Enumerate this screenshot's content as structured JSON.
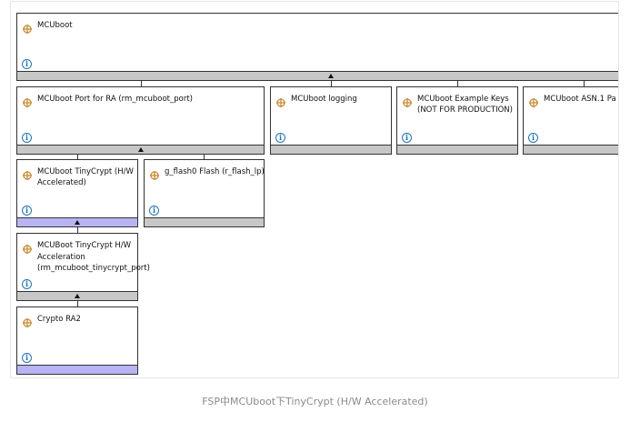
{
  "blocks": {
    "mcuboot": {
      "title": "MCUboot"
    },
    "port": {
      "title": "MCUboot Port for RA (rm_mcuboot_port)"
    },
    "logging": {
      "title": "MCUboot logging"
    },
    "keys": {
      "title": "MCUboot Example Keys (NOT FOR PRODUCTION)"
    },
    "asn1": {
      "title": "MCUboot ASN.1 Pa"
    },
    "tinycrypt": {
      "title": "MCUboot TinyCrypt (H/W Accelerated)"
    },
    "flash": {
      "title": "g_flash0 Flash (r_flash_lp)"
    },
    "accel": {
      "title": "MCUBoot TinyCrypt H/W Acceleration (rm_mcuboot_tinycrypt_port)"
    },
    "crypto": {
      "title": "Crypto RA2"
    }
  },
  "icons": {
    "module": "module-gear-icon",
    "info": "info-icon"
  },
  "colors": {
    "bar_gray": "#c7c7c7",
    "bar_blue": "#b7b4f5",
    "info_blue": "#1b75bb",
    "module_orange": "#c98a2e"
  },
  "caption": "FSP中MCUboot下TinyCrypt (H/W Accelerated)"
}
